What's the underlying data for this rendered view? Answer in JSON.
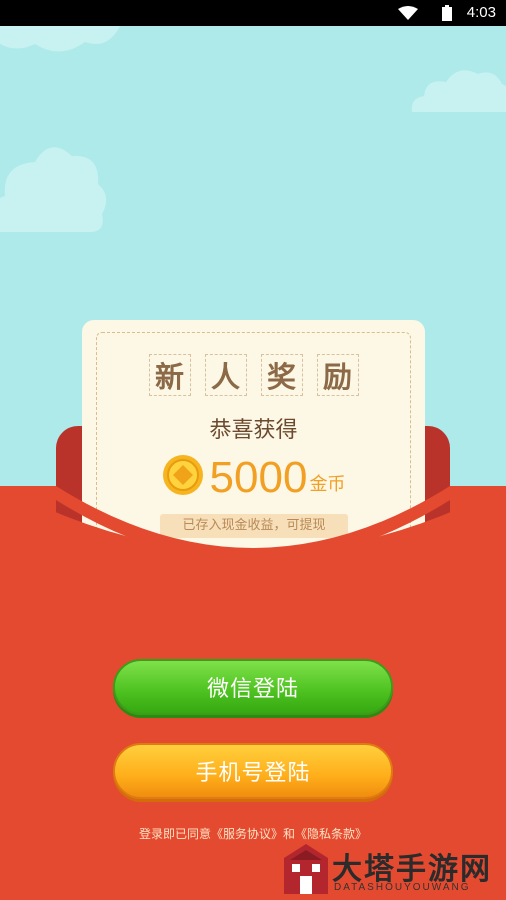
{
  "status_bar": {
    "time": "4:03"
  },
  "card": {
    "title_chars": [
      "新",
      "人",
      "奖",
      "励"
    ],
    "subtitle": "恭喜获得",
    "amount": "5000",
    "unit": "金币",
    "note": "已存入现金收益，可提现"
  },
  "buttons": {
    "wechat_label": "微信登陆",
    "phone_label": "手机号登陆"
  },
  "agreement": "登录即已同意《服务协议》和《隐私条款》",
  "watermark": {
    "title": "大塔手游网",
    "subtitle": "DATASHOUYOUWANG"
  },
  "colors": {
    "sky": "#aeeaea",
    "envelope_red": "#e44a30",
    "wechat_green": "#4cc11f",
    "phone_orange": "#ffae1a",
    "coin_gold": "#f2a024"
  }
}
